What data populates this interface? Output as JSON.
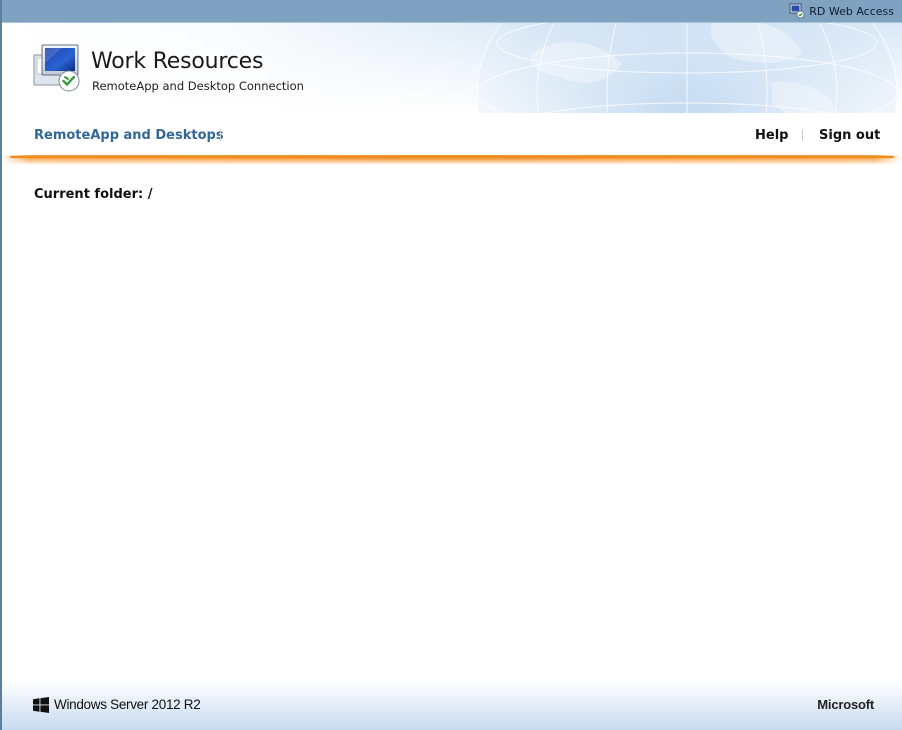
{
  "topbar": {
    "brand_label": "RD Web Access",
    "brand_icon": "rd-web-access-icon"
  },
  "header": {
    "title": "Work Resources",
    "subtitle": "RemoteApp and Desktop Connection",
    "logo_icon": "remoteapp-monitor-icon"
  },
  "nav": {
    "tab_label": "RemoteApp and Desktops",
    "help_label": "Help",
    "signout_label": "Sign out"
  },
  "content": {
    "current_folder": "Current folder: /"
  },
  "footer": {
    "os_label": "Windows Server 2012 R2",
    "vendor_label": "Microsoft",
    "os_logo_icon": "windows-logo-icon"
  },
  "colors": {
    "topbar_bg": "#7fa2c0",
    "nav_tab_text": "#336699",
    "accent_orange": "#f08c1e",
    "footer_bg": "#c6dbf0"
  }
}
